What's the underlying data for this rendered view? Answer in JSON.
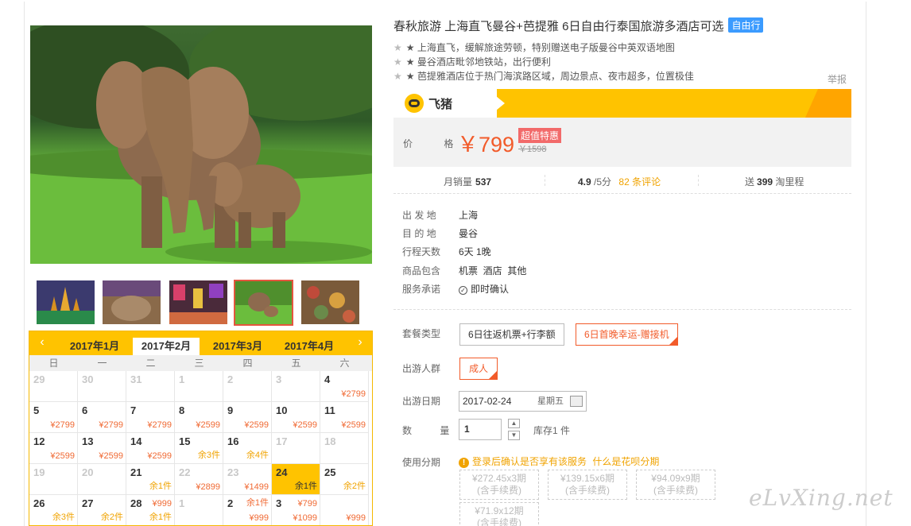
{
  "product": {
    "title": "春秋旅游 上海直飞曼谷+芭提雅 6日自由行泰国旅游多酒店可选",
    "tag": "自由行",
    "features": [
      "★ 上海直飞，缓解旅途劳顿，特别赠送电子版曼谷中英双语地图",
      "★ 曼谷酒店毗邻地铁站，出行便利",
      "★ 芭提雅酒店位于热门海滨路区域，周边景点、夜市超多，位置极佳"
    ],
    "report": "举报"
  },
  "brand": {
    "name": "飞猪",
    "color": "#ffc300"
  },
  "price": {
    "label": "价 格",
    "amount": "￥799",
    "badge": "超值特惠",
    "original": "￥1598"
  },
  "stats": {
    "sales_label": "月销量",
    "sales": "537",
    "rating": "4.9",
    "rating_suffix": "/5分",
    "reviews": "82 条评论",
    "points_prefix": "送",
    "points": "399",
    "points_suffix": "淘里程"
  },
  "info": [
    {
      "label": "出 发 地",
      "value": "上海"
    },
    {
      "label": "目 的 地",
      "value": "曼谷"
    },
    {
      "label": "行程天数",
      "value": "6天 1晚"
    },
    {
      "label": "商品包含",
      "value": "机票  酒店  其他"
    },
    {
      "label": "服务承诺",
      "value": "即时确认"
    }
  ],
  "options": {
    "package_label": "套餐类型",
    "packages": [
      "6日往返机票+行李额",
      "6日首晚幸运-赠接机"
    ],
    "traveler_label": "出游人群",
    "traveler": "成人",
    "date_label": "出游日期",
    "date": "2017-02-24",
    "weekday": "星期五",
    "qty_label": "数 量",
    "qty": "1",
    "stock": "库存1 件",
    "installment_label": "使用分期",
    "installment_warn": "登录后确认是否享有该服务",
    "installment_link": "什么是花呗分期",
    "installments": [
      {
        "amount": "¥272.45x3期",
        "note": "(含手续费)"
      },
      {
        "amount": "¥139.15x6期",
        "note": "(含手续费)"
      },
      {
        "amount": "¥94.09x9期",
        "note": "(含手续费)"
      },
      {
        "amount": "¥71.9x12期",
        "note": "(含手续费)"
      }
    ]
  },
  "calendar": {
    "months": [
      "2017年1月",
      "2017年2月",
      "2017年3月",
      "2017年4月"
    ],
    "active_month": 1,
    "weekdays": [
      "日",
      "一",
      "二",
      "三",
      "四",
      "五",
      "六"
    ],
    "cells": [
      {
        "d": "29",
        "gray": true
      },
      {
        "d": "30",
        "gray": true
      },
      {
        "d": "31",
        "gray": true
      },
      {
        "d": "1",
        "gray": true
      },
      {
        "d": "2",
        "gray": true
      },
      {
        "d": "3",
        "gray": true
      },
      {
        "d": "4",
        "p": "¥2799"
      },
      {
        "d": "5",
        "p": "¥2799"
      },
      {
        "d": "6",
        "p": "¥2799"
      },
      {
        "d": "7",
        "p": "¥2799"
      },
      {
        "d": "8",
        "p": "¥2599"
      },
      {
        "d": "9",
        "p": "¥2599"
      },
      {
        "d": "10",
        "p": "¥2599"
      },
      {
        "d": "11",
        "p": "¥2599"
      },
      {
        "d": "12",
        "p": "¥2599"
      },
      {
        "d": "13",
        "p": "¥2599"
      },
      {
        "d": "14",
        "p": "¥2599"
      },
      {
        "d": "15",
        "p": "余3件",
        "y": true
      },
      {
        "d": "16",
        "p": "余4件",
        "y": true
      },
      {
        "d": "17",
        "gray": true
      },
      {
        "d": "18",
        "gray": true
      },
      {
        "d": "19",
        "gray": true
      },
      {
        "d": "20",
        "gray": true
      },
      {
        "d": "21",
        "p": "余1件",
        "y": true
      },
      {
        "d": "22",
        "p": "¥2899",
        "gray": true
      },
      {
        "d": "23",
        "p": "¥1499",
        "gray": true
      },
      {
        "d": "24",
        "p": "余1件",
        "hl": true
      },
      {
        "d": "25",
        "p": "余2件",
        "y": true
      },
      {
        "d": "26",
        "p": "余3件",
        "y": true
      },
      {
        "d": "27",
        "p": "余2件",
        "y": true
      },
      {
        "d": "28",
        "p": "余1件",
        "y": true,
        "p2": "¥999"
      },
      {
        "d": "1",
        "gray": true
      },
      {
        "d": "2",
        "p": "¥999",
        "p2": "余1件"
      },
      {
        "d": "3",
        "p": "¥1099",
        "p2": "¥799"
      },
      {
        "d": "",
        "p": "¥999"
      }
    ]
  },
  "watermark": "eLvXing.net"
}
